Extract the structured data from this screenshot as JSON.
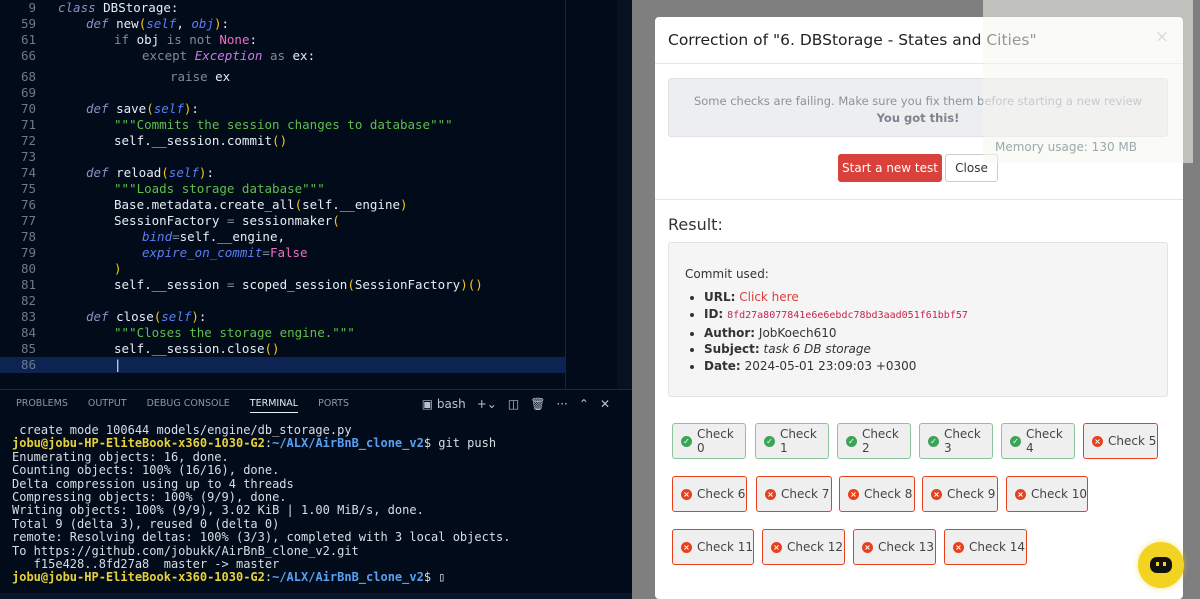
{
  "editor": {
    "lines": [
      {
        "n": "9",
        "seg": [
          [
            "class ",
            "kw"
          ],
          [
            "DBStorage",
            "fn"
          ],
          [
            ":",
            "fn"
          ]
        ],
        "indent": 0
      },
      {
        "n": "59",
        "seg": [
          [
            "def ",
            "kw"
          ],
          [
            "new",
            "fn"
          ],
          [
            "(",
            "br"
          ],
          [
            "self",
            "pa"
          ],
          [
            ", ",
            "fn"
          ],
          [
            "obj",
            "pa"
          ],
          [
            ")",
            "br"
          ],
          [
            ":",
            "fn"
          ]
        ],
        "indent": 1
      },
      {
        "n": "61",
        "seg": [
          [
            "if ",
            "cm"
          ],
          [
            "obj ",
            "fn"
          ],
          [
            "is not ",
            "cm"
          ],
          [
            "None",
            "cn"
          ],
          [
            ":",
            "fn"
          ]
        ],
        "indent": 2
      },
      {
        "n": "66",
        "seg": [
          [
            "except ",
            "cm"
          ],
          [
            "Exception",
            "ex"
          ],
          [
            " as ",
            "cm"
          ],
          [
            "ex",
            "fn"
          ],
          [
            ":",
            "fn"
          ]
        ],
        "indent": 3
      },
      {
        "n": "68",
        "seg": [
          [
            "raise ",
            "cm"
          ],
          [
            "ex",
            "fn"
          ]
        ],
        "indent": 4
      },
      {
        "n": "69",
        "seg": [],
        "indent": 0
      },
      {
        "n": "70",
        "seg": [
          [
            "def ",
            "kw"
          ],
          [
            "save",
            "fn"
          ],
          [
            "(",
            "br"
          ],
          [
            "self",
            "pa"
          ],
          [
            ")",
            "br"
          ],
          [
            ":",
            "fn"
          ]
        ],
        "indent": 1
      },
      {
        "n": "71",
        "seg": [
          [
            "\"\"\"Commits the session changes to database\"\"\"",
            "st"
          ]
        ],
        "indent": 2
      },
      {
        "n": "72",
        "seg": [
          [
            "self.__session.commit",
            "fn"
          ],
          [
            "()",
            "br"
          ]
        ],
        "indent": 2
      },
      {
        "n": "73",
        "seg": [],
        "indent": 0
      },
      {
        "n": "74",
        "seg": [
          [
            "def ",
            "kw"
          ],
          [
            "reload",
            "fn"
          ],
          [
            "(",
            "br"
          ],
          [
            "self",
            "pa"
          ],
          [
            ")",
            "br"
          ],
          [
            ":",
            "fn"
          ]
        ],
        "indent": 1
      },
      {
        "n": "75",
        "seg": [
          [
            "\"\"\"Loads storage database\"\"\"",
            "st"
          ]
        ],
        "indent": 2
      },
      {
        "n": "76",
        "seg": [
          [
            "Base.metadata.create_all",
            "fn"
          ],
          [
            "(",
            "br"
          ],
          [
            "self.__engine",
            "fn"
          ],
          [
            ")",
            "br"
          ]
        ],
        "indent": 2
      },
      {
        "n": "77",
        "seg": [
          [
            "SessionFactory ",
            "fn"
          ],
          [
            "= ",
            "cm"
          ],
          [
            "sessionmaker",
            "fn"
          ],
          [
            "(",
            "br"
          ]
        ],
        "indent": 2
      },
      {
        "n": "78",
        "seg": [
          [
            "bind",
            "pa"
          ],
          [
            "=",
            "cm"
          ],
          [
            "self.__engine,",
            "fn"
          ]
        ],
        "indent": 3
      },
      {
        "n": "79",
        "seg": [
          [
            "expire_on_commit",
            "pa"
          ],
          [
            "=",
            "cm"
          ],
          [
            "False",
            "cn"
          ]
        ],
        "indent": 3
      },
      {
        "n": "80",
        "seg": [
          [
            ")",
            "br"
          ]
        ],
        "indent": 2
      },
      {
        "n": "81",
        "seg": [
          [
            "self.__session ",
            "fn"
          ],
          [
            "= ",
            "cm"
          ],
          [
            "scoped_session",
            "fn"
          ],
          [
            "(",
            "br"
          ],
          [
            "SessionFactory",
            "fn"
          ],
          [
            ")()",
            "br"
          ]
        ],
        "indent": 2
      },
      {
        "n": "82",
        "seg": [],
        "indent": 0
      },
      {
        "n": "83",
        "seg": [
          [
            "def ",
            "kw"
          ],
          [
            "close",
            "fn"
          ],
          [
            "(",
            "br"
          ],
          [
            "self",
            "pa"
          ],
          [
            ")",
            "br"
          ],
          [
            ":",
            "fn"
          ]
        ],
        "indent": 1
      },
      {
        "n": "84",
        "seg": [
          [
            "\"\"\"Closes the storage engine.\"\"\"",
            "st"
          ]
        ],
        "indent": 2
      },
      {
        "n": "85",
        "seg": [
          [
            "self.__session.close",
            "fn"
          ],
          [
            "()",
            "br"
          ]
        ],
        "indent": 2
      },
      {
        "n": "86",
        "seg": [
          [
            "|",
            "fn"
          ]
        ],
        "indent": 2
      }
    ]
  },
  "panel": {
    "tabs": [
      "PROBLEMS",
      "OUTPUT",
      "DEBUG CONSOLE",
      "TERMINAL",
      "PORTS"
    ],
    "active": "TERMINAL",
    "shell": "bash"
  },
  "terminal": {
    "line0": " create mode 100644 models/engine/db_storage.py",
    "prompt_user": "jobu@jobu-HP-EliteBook-x360-1030-G2",
    "prompt_path": "~/ALX/AirBnB_clone_v2",
    "cmd": "$ git push",
    "output": [
      "Enumerating objects: 16, done.",
      "Counting objects: 100% (16/16), done.",
      "Delta compression using up to 4 threads",
      "Compressing objects: 100% (9/9), done.",
      "Writing objects: 100% (9/9), 3.02 KiB | 1.00 MiB/s, done.",
      "Total 9 (delta 3), reused 0 (delta 0)",
      "remote: Resolving deltas: 100% (3/3), completed with 3 local objects.",
      "To https://github.com/jobukk/AirBnB_clone_v2.git",
      "   f15e428..8fd27a8  master -> master"
    ],
    "end": "$ "
  },
  "modal": {
    "title": "Correction of \"6. DBStorage - States and Cities\"",
    "close_icon": "×",
    "alert": "Some checks are failing. Make sure you fix them before starting a new review",
    "alert_bold": "You got this!",
    "start_button": "Start a new test",
    "close_button": "Close",
    "result_label": "Result:",
    "commit_label": "Commit used:",
    "url_label": "URL:",
    "url_value": "Click here",
    "id_label": "ID:",
    "id_value": "8fd27a8077841e6e6ebdc78bd3aad051f61bbf57",
    "author_label": "Author:",
    "author_value": "JobKoech610",
    "subject_label": "Subject:",
    "subject_value": "task 6 DB storage",
    "date_label": "Date:",
    "date_value": "2024-05-01 23:09:03 +0300",
    "checks": [
      {
        "label": "Check 0",
        "status": "pass"
      },
      {
        "label": "Check 1",
        "status": "pass"
      },
      {
        "label": "Check 2",
        "status": "pass"
      },
      {
        "label": "Check 3",
        "status": "pass"
      },
      {
        "label": "Check 4",
        "status": "pass"
      },
      {
        "label": "Check 5",
        "status": "fail"
      },
      {
        "label": "Check 6",
        "status": "fail"
      },
      {
        "label": "Check 7",
        "status": "fail"
      },
      {
        "label": "Check 8",
        "status": "fail"
      },
      {
        "label": "Check 9",
        "status": "fail"
      },
      {
        "label": "Check 10",
        "status": "fail"
      },
      {
        "label": "Check 11",
        "status": "fail"
      },
      {
        "label": "Check 12",
        "status": "fail"
      },
      {
        "label": "Check 13",
        "status": "fail"
      },
      {
        "label": "Check 14",
        "status": "fail"
      }
    ]
  },
  "memory": {
    "text": "Memory usage: 130 MB"
  },
  "colors": {
    "pass": "#3aa655",
    "fail": "#e8401c",
    "primary": "#d9413a"
  }
}
